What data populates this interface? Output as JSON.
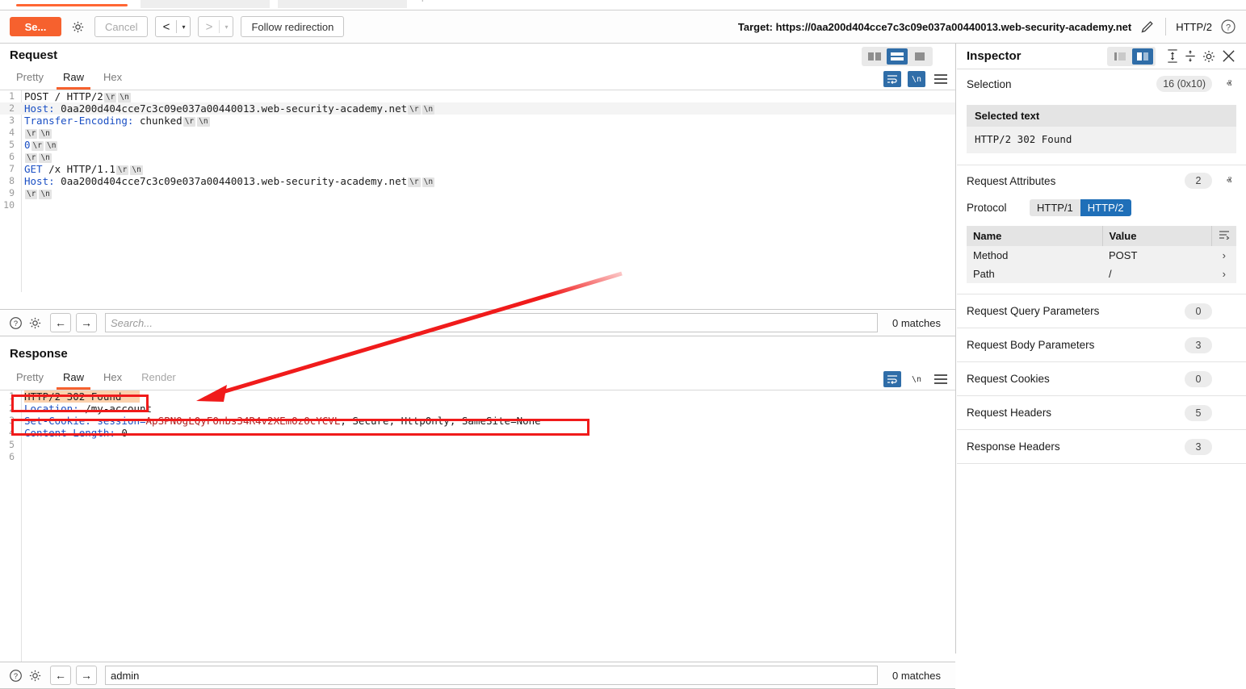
{
  "toolbar": {
    "send_label": "Se...",
    "settings_icon": "gear-icon",
    "cancel_label": "Cancel",
    "back_label": "<",
    "forward_label": ">",
    "caret": "▾",
    "follow_redirection_label": "Follow redirection",
    "target_label": "Target: https://0aa200d404cce7c3c09e037a00440013.web-security-academy.net",
    "edit_icon": "pencil-icon",
    "protocol_label": "HTTP/2",
    "help_icon": "question-circle-icon",
    "accent_color": "#f6612e"
  },
  "request_panel": {
    "title": "Request",
    "tabs": [
      {
        "label": "Pretty",
        "selected": false,
        "dim": false
      },
      {
        "label": "Raw",
        "selected": true,
        "dim": false
      },
      {
        "label": "Hex",
        "selected": false,
        "dim": false
      }
    ],
    "layout_toggles": [
      {
        "name": "side-by-side-layout",
        "selected": false
      },
      {
        "name": "stacked-layout",
        "selected": true
      },
      {
        "name": "single-pane-layout",
        "selected": false
      }
    ],
    "tools": [
      {
        "name": "word-wrap-toggle",
        "glyph": "↩",
        "active": true
      },
      {
        "name": "show-newlines-toggle",
        "glyph": "\\n",
        "active": true
      },
      {
        "name": "editor-menu",
        "glyph": "menu",
        "active": false
      }
    ],
    "lines": [
      {
        "n": "1",
        "parts": [
          {
            "t": "POST / HTTP/2",
            "c": "k-str"
          },
          {
            "t": "\\r",
            "c": "crlf"
          },
          {
            "t": "\\n",
            "c": "crlf"
          }
        ]
      },
      {
        "n": "2",
        "alt": true,
        "parts": [
          {
            "t": "Host:",
            "c": "k-hdr"
          },
          {
            "t": " 0aa200d404cce7c3c09e037a00440013.web-security-academy.net",
            "c": "k-str"
          },
          {
            "t": "\\r",
            "c": "crlf"
          },
          {
            "t": "\\n",
            "c": "crlf"
          }
        ]
      },
      {
        "n": "3",
        "parts": [
          {
            "t": "Transfer-Encoding:",
            "c": "k-hdr"
          },
          {
            "t": " chunked",
            "c": "k-str"
          },
          {
            "t": "\\r",
            "c": "crlf"
          },
          {
            "t": "\\n",
            "c": "crlf"
          }
        ]
      },
      {
        "n": "4",
        "parts": [
          {
            "t": "\\r",
            "c": "crlf"
          },
          {
            "t": "\\n",
            "c": "crlf"
          }
        ]
      },
      {
        "n": "5",
        "parts": [
          {
            "t": "0",
            "c": "k-blu"
          },
          {
            "t": "\\r",
            "c": "crlf"
          },
          {
            "t": "\\n",
            "c": "crlf"
          }
        ]
      },
      {
        "n": "6",
        "parts": [
          {
            "t": "\\r",
            "c": "crlf"
          },
          {
            "t": "\\n",
            "c": "crlf"
          }
        ]
      },
      {
        "n": "7",
        "parts": [
          {
            "t": "GET",
            "c": "k-blu"
          },
          {
            "t": " /x HTTP/1.1",
            "c": "k-str"
          },
          {
            "t": "\\r",
            "c": "crlf"
          },
          {
            "t": "\\n",
            "c": "crlf"
          }
        ]
      },
      {
        "n": "8",
        "parts": [
          {
            "t": "Host:",
            "c": "k-hdr"
          },
          {
            "t": " 0aa200d404cce7c3c09e037a00440013.web-security-academy.net",
            "c": "k-str"
          },
          {
            "t": "\\r",
            "c": "crlf"
          },
          {
            "t": "\\n",
            "c": "crlf"
          }
        ]
      },
      {
        "n": "9",
        "parts": [
          {
            "t": "\\r",
            "c": "crlf"
          },
          {
            "t": "\\n",
            "c": "crlf"
          }
        ]
      },
      {
        "n": "10",
        "parts": []
      }
    ],
    "find": {
      "help_icon": "question-circle-icon",
      "settings_icon": "gear-icon",
      "prev_label": "←",
      "next_label": "→",
      "value": "",
      "placeholder": "Search...",
      "matches": "0 matches"
    }
  },
  "response_panel": {
    "title": "Response",
    "tabs": [
      {
        "label": "Pretty",
        "selected": false,
        "dim": false
      },
      {
        "label": "Raw",
        "selected": true,
        "dim": false
      },
      {
        "label": "Hex",
        "selected": false,
        "dim": false
      },
      {
        "label": "Render",
        "selected": false,
        "dim": true
      }
    ],
    "tools": [
      {
        "name": "word-wrap-toggle",
        "glyph": "↩",
        "active": true
      },
      {
        "name": "show-newlines-toggle",
        "glyph": "\\n",
        "active": false
      },
      {
        "name": "editor-menu",
        "glyph": "menu",
        "active": false
      }
    ],
    "lines": [
      {
        "n": "1",
        "selected": true,
        "parts": [
          {
            "t": "HTTP/2 302 Found",
            "c": "k-str"
          }
        ]
      },
      {
        "n": "2",
        "parts": [
          {
            "t": "Location:",
            "c": "k-hdr"
          },
          {
            "t": " /my-account",
            "c": "k-str"
          }
        ]
      },
      {
        "n": "3",
        "parts": [
          {
            "t": "Set-Cookie:",
            "c": "k-hdr"
          },
          {
            "t": " session=",
            "c": "k-blu"
          },
          {
            "t": "ApSPNOgLQyFOnbs34R4v2XEmOzOcYCVL",
            "c": "k-red"
          },
          {
            "t": "; Secure; HttpOnly; SameSite=None",
            "c": "k-str"
          }
        ]
      },
      {
        "n": "4",
        "parts": [
          {
            "t": "Content-Length:",
            "c": "k-hdr"
          },
          {
            "t": " 0",
            "c": "k-str"
          }
        ]
      },
      {
        "n": "5",
        "parts": []
      },
      {
        "n": "6",
        "parts": []
      }
    ],
    "find": {
      "help_icon": "question-circle-icon",
      "settings_icon": "gear-icon",
      "prev_label": "←",
      "next_label": "→",
      "value": "admin",
      "placeholder": "Search...",
      "matches": "0 matches"
    }
  },
  "inspector": {
    "title": "Inspector",
    "layout_toggles": [
      {
        "name": "inspector-collapse-layout",
        "selected": false
      },
      {
        "name": "inspector-expand-layout",
        "selected": true
      }
    ],
    "tools": [
      {
        "name": "expand-all-icon"
      },
      {
        "name": "collapse-all-icon"
      },
      {
        "name": "gear-icon"
      },
      {
        "name": "close-icon"
      }
    ],
    "selection": {
      "label": "Selection",
      "count": "16 (0x10)",
      "chevron": "ⱏ",
      "selected_text_header": "Selected text",
      "selected_text_value": "HTTP/2 302 Found"
    },
    "request_attributes": {
      "label": "Request Attributes",
      "count": "2",
      "chevron": "ⱏ",
      "protocol_label": "Protocol",
      "protocol_options": [
        {
          "label": "HTTP/1",
          "selected": false
        },
        {
          "label": "HTTP/2",
          "selected": true
        }
      ],
      "columns": [
        "Name",
        "Value"
      ],
      "sort_icon": "sort-icon",
      "rows": [
        {
          "name": "Method",
          "value": "POST",
          "expand": "›"
        },
        {
          "name": "Path",
          "value": "/",
          "expand": "›"
        }
      ]
    },
    "sections": [
      {
        "label": "Request Query Parameters",
        "count": "0",
        "chevron": "ⱟ"
      },
      {
        "label": "Request Body Parameters",
        "count": "3",
        "chevron": "ⱟ"
      },
      {
        "label": "Request Cookies",
        "count": "0",
        "chevron": "ⱟ"
      },
      {
        "label": "Request Headers",
        "count": "5",
        "chevron": "ⱟ"
      },
      {
        "label": "Response Headers",
        "count": "3",
        "chevron": "ⱟ"
      }
    ]
  },
  "annotations": {
    "status_box_name": "status-line-highlight-box",
    "cookie_box_name": "set-cookie-highlight-box",
    "arrow_name": "callout-arrow",
    "color": "#f01b1b"
  }
}
